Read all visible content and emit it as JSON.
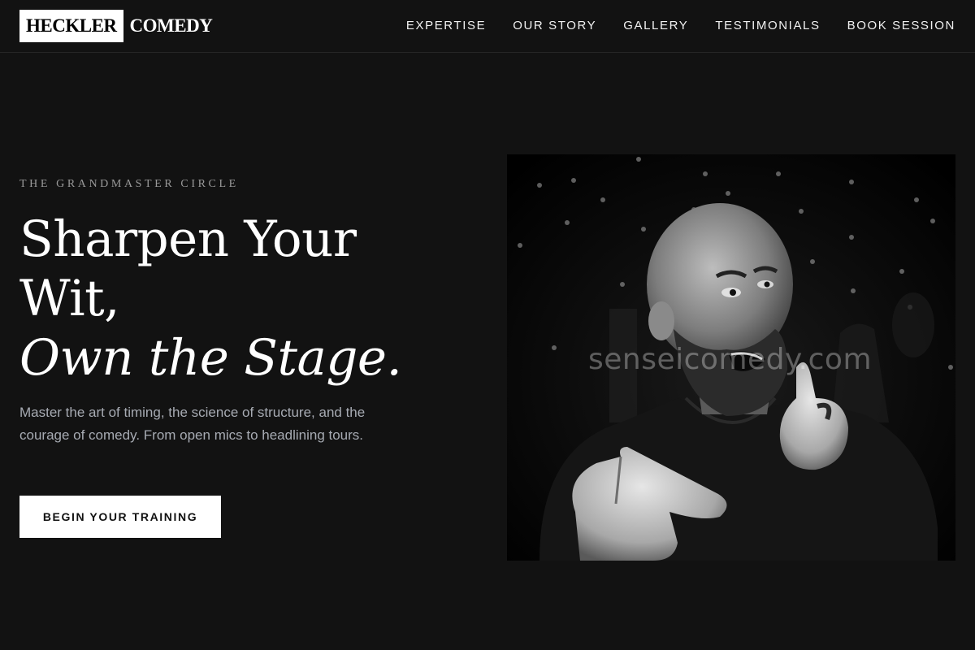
{
  "brand": {
    "logo_part1": "HECKLER",
    "logo_part2": "COMEDY"
  },
  "nav": {
    "items": [
      "EXPERTISE",
      "OUR STORY",
      "GALLERY",
      "TESTIMONIALS",
      "BOOK SESSION"
    ]
  },
  "hero": {
    "kicker": "THE GRANDMASTER CIRCLE",
    "title_line1": "Sharpen Your Wit,",
    "title_line2": "Own the Stage.",
    "description": "Master the art of timing, the science of structure, and the courage of comedy. From open mics to headlining tours.",
    "cta_label": "BEGIN YOUR TRAINING"
  },
  "photo": {
    "watermark": "senseicomedy.com"
  },
  "colors": {
    "background": "#121212",
    "cta_bg": "#ffffff",
    "muted_text": "#a7abb3"
  }
}
